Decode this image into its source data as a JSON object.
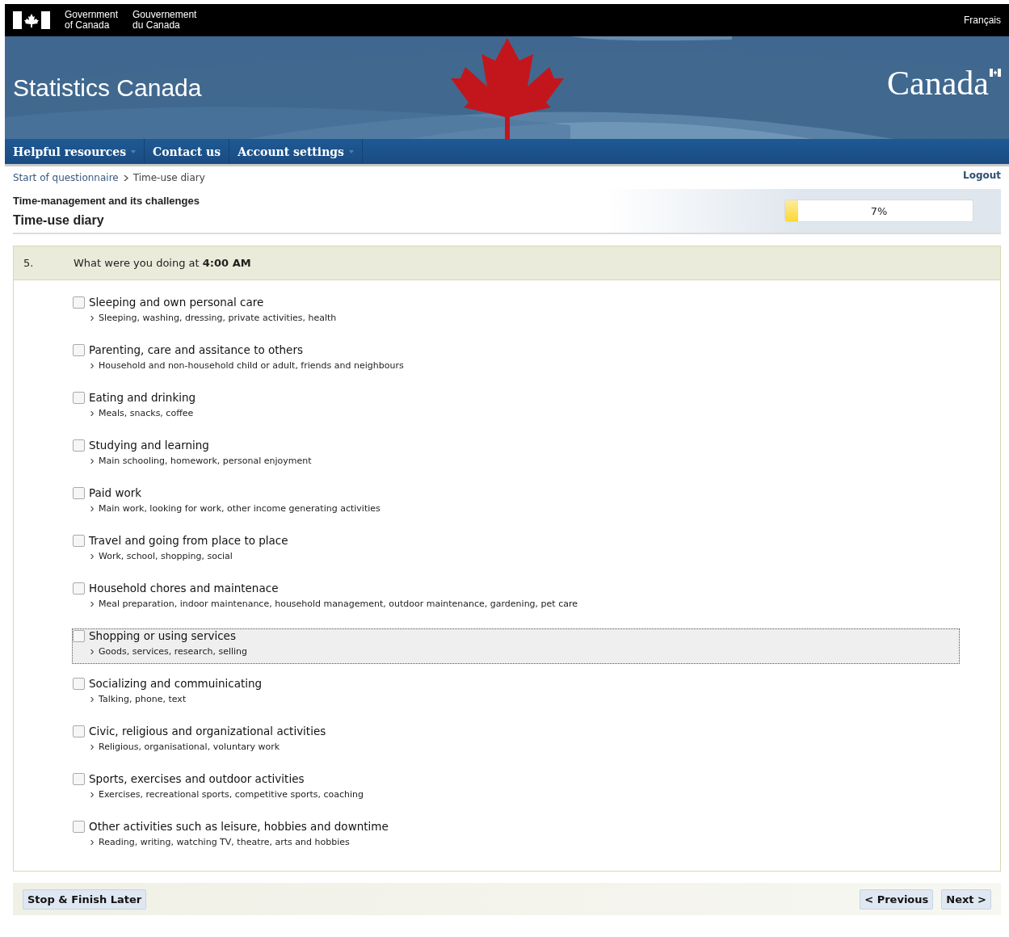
{
  "gov_bar": {
    "english": [
      "Government",
      "of Canada"
    ],
    "french": [
      "Gouvernement",
      "du Canada"
    ],
    "language_link": "Français"
  },
  "banner": {
    "title": "Statistics Canada",
    "wordmark": "Canada"
  },
  "nav": [
    {
      "label": "Helpful resources",
      "has_menu": true
    },
    {
      "label": "Contact us",
      "has_menu": false
    },
    {
      "label": "Account settings",
      "has_menu": true
    }
  ],
  "breadcrumb": [
    "Start of questionnaire",
    "Time-use diary"
  ],
  "logout": "Logout",
  "survey": {
    "name": "Time-management and its challenges",
    "section": "Time-use diary"
  },
  "progress": {
    "level": 0.07,
    "reading": "7%"
  },
  "question": {
    "number": "5.",
    "text": "What were you doing at **4:00 AM**"
  },
  "options": [
    {
      "label": "Sleeping and own personal care",
      "hint": "Sleeping, washing, dressing, private activities, health",
      "selected": false,
      "focused": false
    },
    {
      "label": "Parenting, care and assitance to others",
      "hint": "Household and non-household child or adult, friends and neighbours",
      "selected": false,
      "focused": false
    },
    {
      "label": "Eating and drinking",
      "hint": "Meals, snacks, coffee",
      "selected": false,
      "focused": false
    },
    {
      "label": "Studying and learning",
      "hint": "Main schooling, homework, personal enjoyment",
      "selected": false,
      "focused": false
    },
    {
      "label": "Paid work",
      "hint": "Main work, looking for work, other income generating activities",
      "selected": false,
      "focused": false
    },
    {
      "label": "Travel and going from place to place",
      "hint": "Work, school, shopping, social",
      "selected": false,
      "focused": false
    },
    {
      "label": "Household chores and maintenace",
      "hint": "Meal preparation, indoor maintenance, household management, outdoor maintenance, gardening, pet care",
      "selected": false,
      "focused": false
    },
    {
      "label": "Shopping or using services",
      "hint": "Goods, services, research, selling",
      "selected": false,
      "focused": true
    },
    {
      "label": "Socializing and commuinicating",
      "hint": "Talking, phone, text",
      "selected": false,
      "focused": false
    },
    {
      "label": "Civic, religious and organizational activities",
      "hint": "Religious, organisational, voluntary work",
      "selected": false,
      "focused": false
    },
    {
      "label": "Sports, exercises and outdoor activities",
      "hint": "Exercises, recreational sports, competitive sports, coaching",
      "selected": false,
      "focused": false
    },
    {
      "label": "Other activities such as leisure, hobbies and downtime",
      "hint": "Reading, writing, watching TV, theatre, arts and hobbies",
      "selected": false,
      "focused": false
    }
  ],
  "buttons": {
    "left": [
      "Stop & Finish Later"
    ],
    "right": [
      "< Previous",
      "Next >"
    ]
  }
}
